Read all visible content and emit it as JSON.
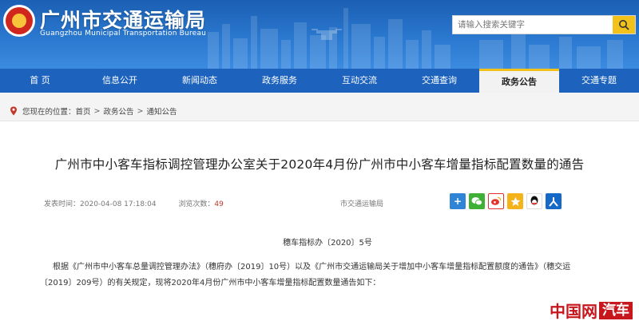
{
  "header": {
    "title": "广州市交通运输局",
    "subtitle": "Guangzhou Municipal Transportation Bureau",
    "search_placeholder": "请输入搜索关键字"
  },
  "nav": {
    "items": [
      {
        "label": "首 页",
        "active": false
      },
      {
        "label": "信息公开",
        "active": false
      },
      {
        "label": "新闻动态",
        "active": false
      },
      {
        "label": "政务服务",
        "active": false
      },
      {
        "label": "互动交流",
        "active": false
      },
      {
        "label": "交通查询",
        "active": false
      },
      {
        "label": "政务公告",
        "active": true
      },
      {
        "label": "交通专题",
        "active": false
      }
    ]
  },
  "breadcrumb": {
    "prefix": "您现在的位置：",
    "items": [
      "首页",
      "政务公告",
      "通知公告"
    ],
    "separator": ">"
  },
  "article": {
    "title": "广州市中小客车指标调控管理办公室关于2020年4月份广州市中小客车增量指标配置数量的通告",
    "publish_label": "发表时间：",
    "publish_time": "2020-04-08 17:18:04",
    "views_label": "浏览次数：",
    "views_count": "49",
    "source": "市交通运输局",
    "doc_number": "穗车指标办〔2020〕5号",
    "paragraph_line1": "根据《广州市中小客车总量调控管理办法》（穗府办〔2019〕10号）以及《广州市交通运输局关于增加中小客车增量指标配置额度的通告》（穗交运",
    "paragraph_line2": "〔2019〕209号）的有关规定，现将2020年4月份广州市中小客车增量指标配置数量通告如下："
  },
  "share": {
    "icons": [
      "plus-share-icon",
      "wechat-icon",
      "weibo-icon",
      "qzone-icon",
      "qq-icon",
      "renren-icon"
    ],
    "colors": [
      "#2f84d6",
      "#3fb036",
      "#e6302b",
      "#f4b21b",
      "#1a9ee0",
      "#1669c7"
    ]
  },
  "watermark": {
    "left": "中国网",
    "right": "汽车"
  },
  "colors": {
    "nav_bg": "#1d63be",
    "accent": "#f2c21b",
    "brand_red": "#c8161d"
  }
}
